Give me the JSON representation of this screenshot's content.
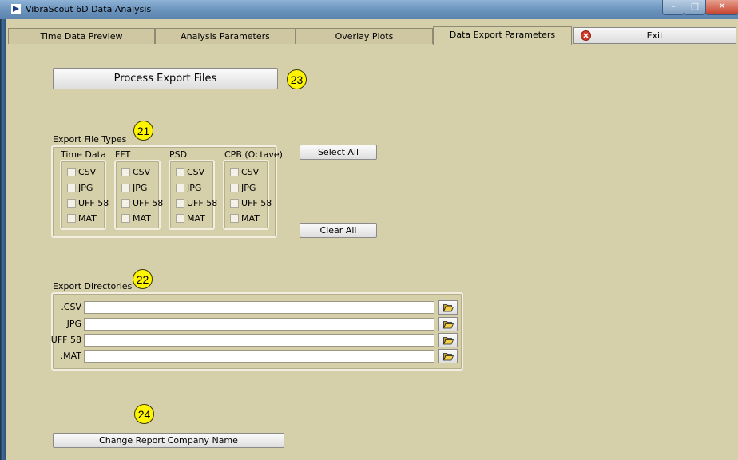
{
  "window": {
    "title": "VibraScout 6D Data Analysis"
  },
  "tabs": [
    {
      "label": "Time Data Preview"
    },
    {
      "label": "Analysis Parameters"
    },
    {
      "label": "Overlay Plots"
    },
    {
      "label": "Data Export Parameters"
    }
  ],
  "exit_label": "Exit",
  "process_button": "Process Export Files",
  "badges": {
    "process": "23",
    "file_types": "21",
    "directories": "22",
    "company": "24"
  },
  "file_types": {
    "title": "Export File Types",
    "columns": [
      {
        "label": "Time Data",
        "options": [
          "CSV",
          "JPG",
          "UFF 58",
          "MAT"
        ]
      },
      {
        "label": "FFT",
        "options": [
          "CSV",
          "JPG",
          "UFF 58",
          "MAT"
        ]
      },
      {
        "label": "PSD",
        "options": [
          "CSV",
          "JPG",
          "UFF 58",
          "MAT"
        ]
      },
      {
        "label": "CPB (Octave)",
        "options": [
          "CSV",
          "JPG",
          "UFF 58",
          "MAT"
        ]
      }
    ],
    "select_all": "Select All",
    "clear_all": "Clear All"
  },
  "directories": {
    "title": "Export Directories",
    "rows": [
      {
        "label": ".CSV",
        "value": ""
      },
      {
        "label": "JPG",
        "value": ""
      },
      {
        "label": "UFF 58",
        "value": ""
      },
      {
        "label": ".MAT",
        "value": ""
      }
    ]
  },
  "company_button": "Change Report Company Name",
  "colors": {
    "panel": "#d5cfaa",
    "badge": "#fff500",
    "titlebar": "#6c94bd"
  }
}
